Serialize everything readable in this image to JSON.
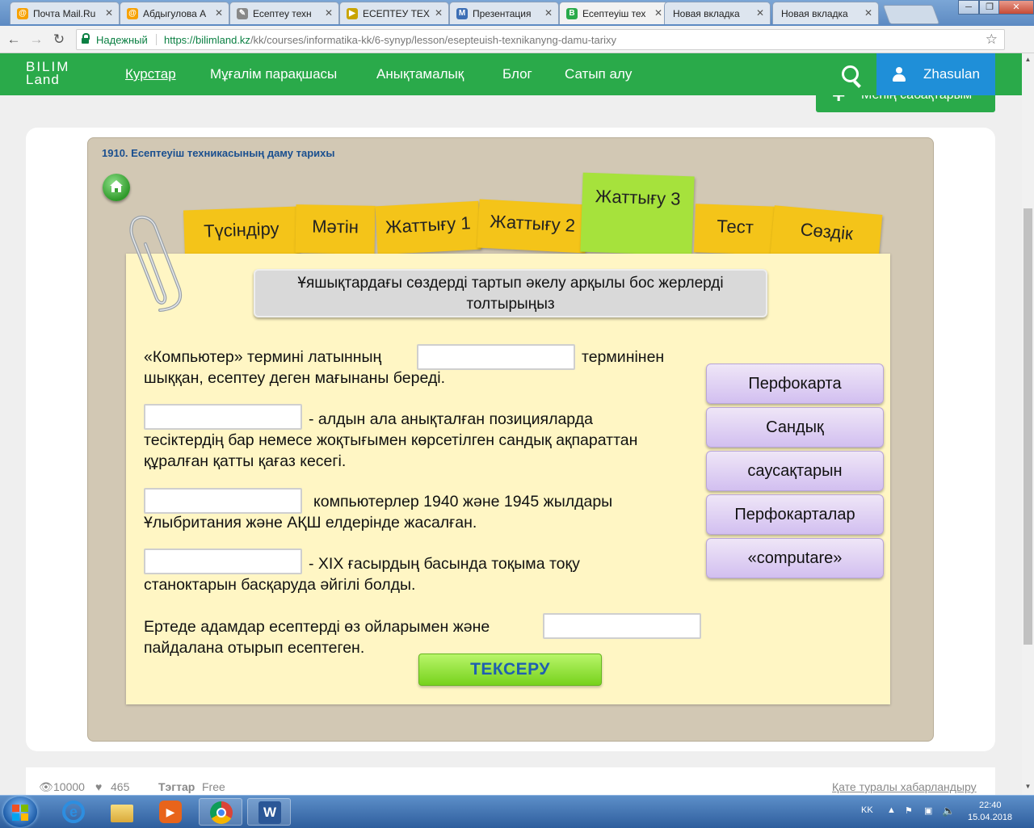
{
  "browser": {
    "tabs": [
      {
        "title": "Почта Mail.Ru",
        "fav_color": "#f7a100",
        "fav_glyph": "@",
        "active": false
      },
      {
        "title": "Абдыгулова А",
        "fav_color": "#f7a100",
        "fav_glyph": "@",
        "active": false
      },
      {
        "title": "Есептеу техн",
        "fav_color": "#888888",
        "fav_glyph": "✎",
        "active": false
      },
      {
        "title": "ЕСЕПТЕУ ТЕХ",
        "fav_color": "#c9a400",
        "fav_glyph": "▶",
        "active": false
      },
      {
        "title": "Презентация",
        "fav_color": "#3d6fb5",
        "fav_glyph": "M",
        "active": false
      },
      {
        "title": "Есептеуіш тех",
        "fav_color": "#2aaa4a",
        "fav_glyph": "B",
        "active": true
      },
      {
        "title": "Новая вкладка",
        "fav_color": "",
        "fav_glyph": "",
        "active": false
      },
      {
        "title": "Новая вкладка",
        "fav_color": "",
        "fav_glyph": "",
        "active": false
      }
    ],
    "secure_label": "Надежный",
    "url_scheme_host": "https://bilimland.kz",
    "url_path": "/kk/courses/informatika-kk/6-synyp/lesson/esepteuish-texnikanyng-damu-tarixy"
  },
  "site": {
    "logo_line1": "BILIM",
    "logo_line2": "Land",
    "nav": [
      "Курстар",
      "Мұғалім парақшасы",
      "Анықтамалық",
      "Блог",
      "Сатып алу"
    ],
    "user_name": "Zhasulan",
    "my_lessons_label": "Менің сабақтарым",
    "brand_green": "#2aaa4a",
    "user_blue": "#1f8fd8"
  },
  "lesson": {
    "title": "1910. Есептеуіш техникасының даму тарихы",
    "tabs": [
      "Түсіндіру",
      "Мәтін",
      "Жаттығу 1",
      "Жаттығу 2",
      "Жаттығу 3",
      "Тест",
      "Сөздік"
    ],
    "active_tab": "Жаттығу 3",
    "instruction": "Ұяшықтардағы сөздерді тартып әкелу арқылы бос жерлерді толтырыңыз",
    "questions": [
      {
        "before": "«Компьютер» термині латынның",
        "after": "терминінен",
        "rest": "шыққан, есептеу деген мағынаны береді."
      },
      {
        "before": "",
        "after": "- алдын ала анықталған позицияларда",
        "rest": "тесіктердің бар немесе жоқтығымен көрсетілген сандық ақпараттан құралған қатты қағаз кесегі."
      },
      {
        "before": "",
        "after": "компьютерлер 1940 және 1945 жылдары",
        "rest": "Ұлыбритания және АҚШ елдерінде жасалған."
      },
      {
        "before": "",
        "after": "- XIX ғасырдың басында тоқыма тоқу",
        "rest": "станоктарын басқаруда әйгілі болды."
      },
      {
        "before": "Ертеде адамдар есептерді өз ойларымен және",
        "after": "",
        "rest": "пайдалана отырып есептеген."
      }
    ],
    "options": [
      "Перфокарта",
      "Сандық",
      "саусақтарын",
      "Перфокарталар",
      "«computare»"
    ],
    "check_label": "ТЕКСЕРУ"
  },
  "footer": {
    "views": "10000",
    "likes": "465",
    "tags_label": "Тэгтар",
    "tags_value": "Free",
    "report_link": "Қате туралы хабарландыру"
  },
  "taskbar": {
    "lang": "KK",
    "time": "22:40",
    "date": "15.04.2018"
  }
}
